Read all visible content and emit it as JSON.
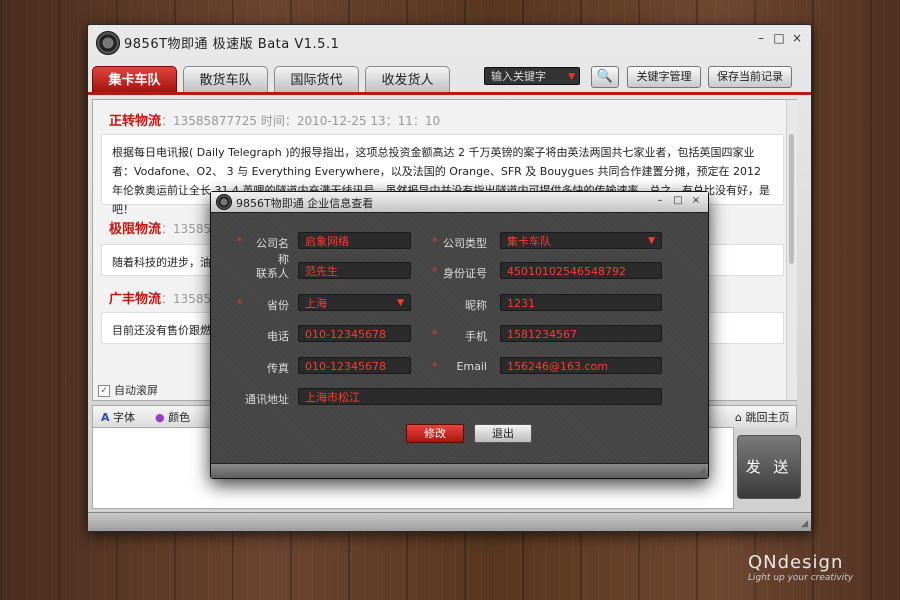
{
  "window": {
    "title": "9856T物即通  极速版  Bata  V1.5.1",
    "min": "–",
    "max": "□",
    "close": "×"
  },
  "tabs": [
    "集卡车队",
    "散货车队",
    "国际货代",
    "收发货人"
  ],
  "toolbar": {
    "keyword_placeholder": "输入关键字",
    "search_icon": "🔍",
    "keyword_mgmt": "关键字管理",
    "save_record": "保存当前记录"
  },
  "messages": [
    {
      "company": "正转物流",
      "meta": "：13585877725  时间：2010-12-25  13：11：10",
      "body": "根据每日电讯报( Daily Telegraph )的报导指出，这项总投资金额高达 2 千万英镑的案子将由英法两国共七家业者，包括英国四家业者：Vodafone、O2、 3 与 Everything Everywhere，以及法国的 Orange、SFR 及 Bouygues 共同合作建置分摊，预定在 2012 年伦敦奥运前让全长 31.4 英哩的隧道内充满无线讯号。虽然报导中并没有指出隧道内可提供多快的传输速率，总之...有总比没有好，是吧！"
    },
    {
      "company": "极限物流",
      "meta": "：13585",
      "body": "随着科技的进步，油"
    },
    {
      "company": "广丰物流",
      "meta": "：13585",
      "body": "目前还没有售价跟燃"
    }
  ],
  "autoscroll": "自动滚屏",
  "tools": {
    "font": "字体",
    "color": "颜色",
    "home": "跳回主页"
  },
  "send": "发 送",
  "dialog": {
    "title": "9856T物即通  企业信息查看",
    "req_mark": "*",
    "labels": {
      "company_name": "公司名称",
      "company_type": "公司类型",
      "contact": "联系人",
      "id_number": "身份证号",
      "province": "省份",
      "nickname": "昵称",
      "phone": "电话",
      "mobile": "手机",
      "fax": "传真",
      "email": "Email",
      "address": "通讯地址"
    },
    "values": {
      "company_name": "启象网络",
      "company_type": "集卡车队",
      "contact": "范先生",
      "id_number": "45010102546548792",
      "province": "上海",
      "nickname": "1231",
      "phone": "010-12345678",
      "mobile": "1581234567",
      "fax": "010-12345678",
      "email": "156246@163.com",
      "address": "上海市松江"
    },
    "edit_button": "修改",
    "exit_button": "退出"
  },
  "brand": {
    "name": "QNdesign",
    "tagline": "Light up your creativity"
  },
  "colors": {
    "accent_red": "#c4140e",
    "field_text": "#ff3a2e"
  }
}
